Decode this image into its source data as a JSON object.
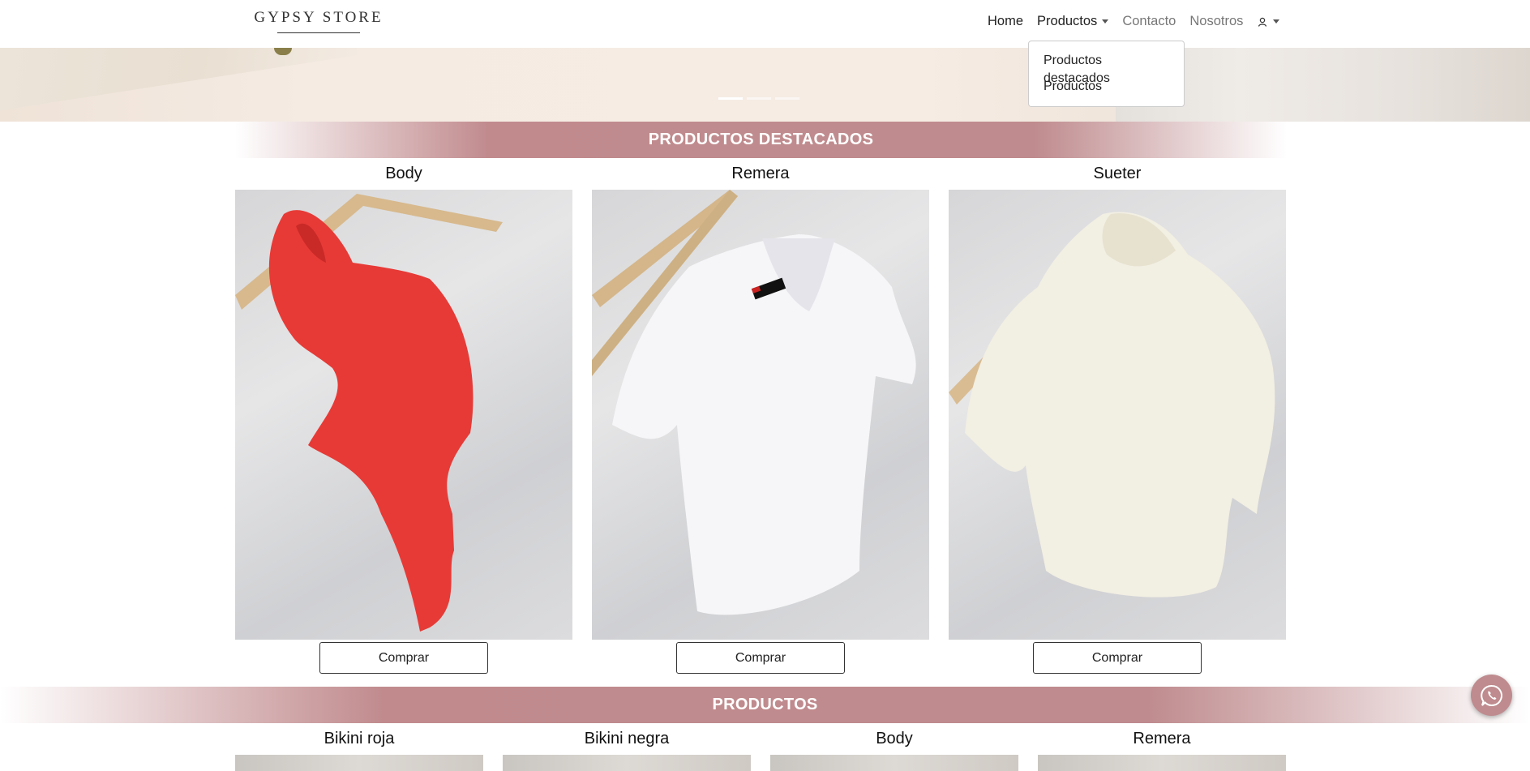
{
  "brand": {
    "name": "GYPSY STORE"
  },
  "nav": {
    "home": "Home",
    "productos": "Productos",
    "contacto": "Contacto",
    "nosotros": "Nosotros"
  },
  "dropdown": {
    "items": [
      "Productos destacados",
      "Productos"
    ]
  },
  "carousel": {
    "slides": 3,
    "active": 1
  },
  "featured": {
    "heading": "PRODUCTOS DESTACADOS",
    "items": [
      {
        "name": "Body",
        "button": "Comprar"
      },
      {
        "name": "Remera",
        "button": "Comprar"
      },
      {
        "name": "Sueter",
        "button": "Comprar"
      }
    ]
  },
  "products": {
    "heading": "PRODUCTOS",
    "items": [
      {
        "name": "Bikini roja"
      },
      {
        "name": "Bikini negra"
      },
      {
        "name": "Body"
      },
      {
        "name": "Remera"
      }
    ]
  },
  "colors": {
    "accent": "#bf8b8e"
  },
  "icons": {
    "user": "user-icon",
    "whatsapp": "whatsapp-icon"
  }
}
